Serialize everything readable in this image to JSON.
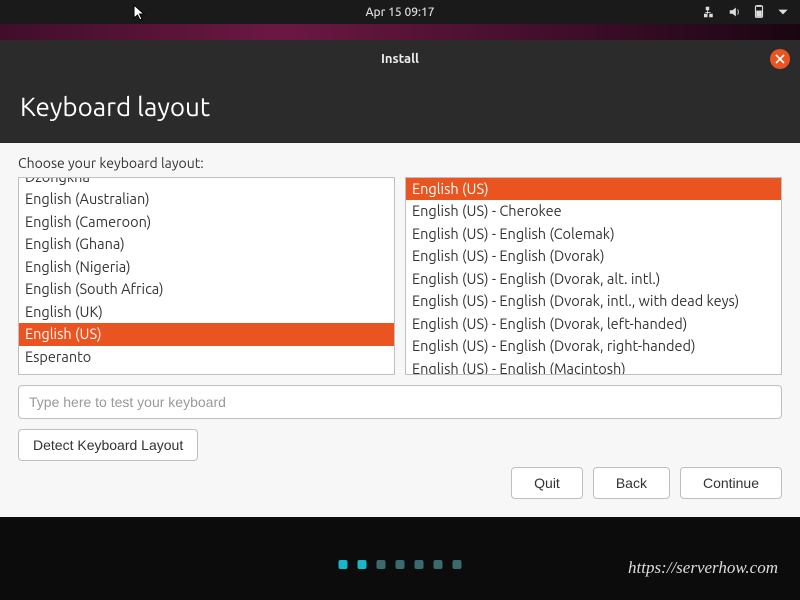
{
  "topbar": {
    "clock": "Apr 15  09:17"
  },
  "window": {
    "title": "Install",
    "heading": "Keyboard layout",
    "prompt": "Choose your keyboard layout:"
  },
  "layouts": {
    "selected_index": 7,
    "items": [
      "Dzongkha",
      "English (Australian)",
      "English (Cameroon)",
      "English (Ghana)",
      "English (Nigeria)",
      "English (South Africa)",
      "English (UK)",
      "English (US)",
      "Esperanto"
    ]
  },
  "variants": {
    "selected_index": 0,
    "items": [
      "English (US)",
      "English (US) - Cherokee",
      "English (US) - English (Colemak)",
      "English (US) - English (Dvorak)",
      "English (US) - English (Dvorak, alt. intl.)",
      "English (US) - English (Dvorak, intl., with dead keys)",
      "English (US) - English (Dvorak, left-handed)",
      "English (US) - English (Dvorak, right-handed)",
      "English (US) - English (Macintosh)"
    ]
  },
  "test_placeholder": "Type here to test your keyboard",
  "buttons": {
    "detect": "Detect Keyboard Layout",
    "quit": "Quit",
    "back": "Back",
    "continue": "Continue"
  },
  "progress": {
    "total": 7,
    "active": [
      0,
      1
    ]
  },
  "watermark": "https://serverhow.com"
}
